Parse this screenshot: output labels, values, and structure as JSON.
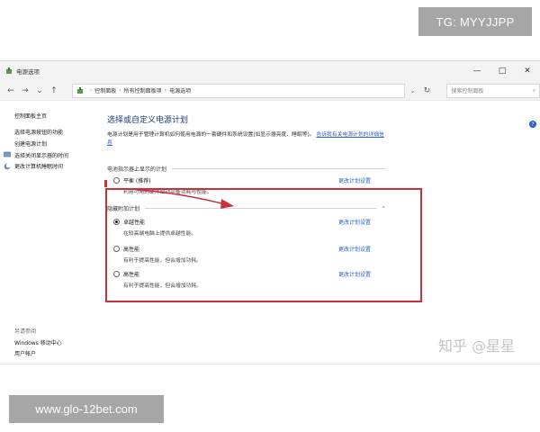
{
  "watermarks": {
    "top": "TG: MYYJJPP",
    "bottom": "www.glo-12bet.com",
    "zhihu": "知乎 @星星"
  },
  "window": {
    "title": "电源选项",
    "controls": {
      "minimize": "—",
      "maximize": "□",
      "close": "✕"
    }
  },
  "nav": {
    "back": "←",
    "forward": "→",
    "dropdown": "⌄",
    "up": "↑",
    "breadcrumb": [
      "控制面板",
      "所有控制面板项",
      "电源选项"
    ],
    "breadcrumb_sep": "›",
    "address_chevron": "⌄",
    "refresh": "↻",
    "search_placeholder": "搜索控制面板",
    "search_icon": "⌕"
  },
  "sidebar": {
    "home": "控制面板主页",
    "items": [
      {
        "label": "选择电源按钮的功能"
      },
      {
        "label": "创建电源计划"
      },
      {
        "label": "选择关闭显示器的时间"
      },
      {
        "label": "更改计算机睡眠时间"
      }
    ],
    "see_also": "另请参阅",
    "mobility_center": "Windows 移动中心",
    "user_accounts": "用户帐户"
  },
  "main": {
    "heading": "选择或自定义电源计划",
    "description": "电源计划是用于管理计算机如何使用电源的一套硬件和系统设置(如显示器亮度、睡眠等)。",
    "description_link": "告诉我有关电源计划的详细信息",
    "shown_section": "电池指示器上显示的计划",
    "hidden_section": "隐藏附加计划",
    "hidden_toggle": "⌃",
    "change_label": "更改计划设置",
    "plans": [
      {
        "name": "平衡 (推荐)",
        "desc": "利用可用的硬件自动平衡功耗与性能。",
        "selected": false
      },
      {
        "name": "卓越性能",
        "desc": "在较高端电脑上提供卓越性能。",
        "selected": true
      },
      {
        "name": "高性能",
        "desc": "有利于提高性能，但会增加功耗。",
        "selected": false
      },
      {
        "name": "高性能",
        "desc": "有利于提高性能，但会增加功耗。",
        "selected": false
      }
    ],
    "help": "?"
  },
  "colors": {
    "annotation_red": "#c8323a",
    "link_blue": "#2a62c9",
    "heading_blue": "#1c3d7a"
  }
}
